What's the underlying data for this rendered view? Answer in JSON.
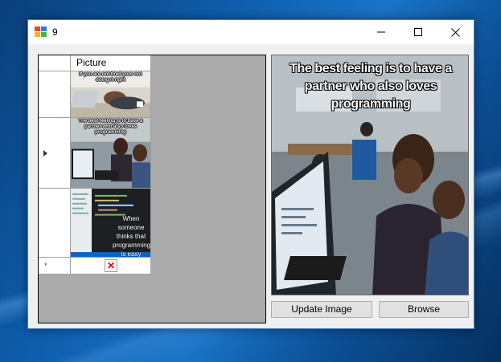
{
  "window": {
    "title": "9",
    "controls": {
      "minimize_icon": "minimize-icon",
      "maximize_icon": "maximize-icon",
      "close_icon": "close-icon"
    }
  },
  "grid": {
    "columns": [
      "Picture"
    ],
    "rows": [
      {
        "caption": "If you are not tired your not doing it right",
        "selected": false
      },
      {
        "caption": "The best feeling is to have a partner who also loves programming",
        "selected": true
      },
      {
        "caption": "When someone thinks that programming is easy",
        "selected": false
      }
    ],
    "new_row_marker": "*"
  },
  "preview": {
    "caption": "The best feeling is to have a partner who also loves programming"
  },
  "buttons": {
    "update": "Update Image",
    "browse": "Browse"
  },
  "colors": {
    "grid_background": "#ababab",
    "window_background": "#f0f0f0",
    "desktop": "#0f5fae",
    "broken_image_x": "#e00000"
  }
}
